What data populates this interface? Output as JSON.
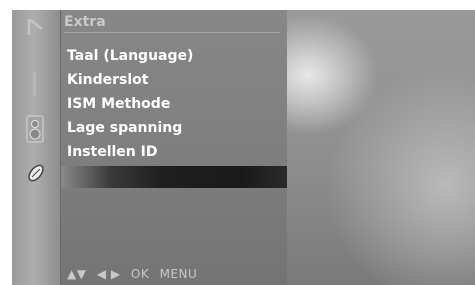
{
  "menu": {
    "title": "Extra",
    "items": [
      {
        "label": "Taal (Language)"
      },
      {
        "label": "Kinderslot"
      },
      {
        "label": "ISM Methode"
      },
      {
        "label": "Lage spanning"
      },
      {
        "label": "Instellen ID"
      }
    ]
  },
  "hint_bar": {
    "updown": "▲▼",
    "leftright": "◀ ▶",
    "ok": "OK",
    "menu": "MENU"
  },
  "side_icons": [
    "input-icon",
    "audio-icon",
    "special-icon"
  ]
}
